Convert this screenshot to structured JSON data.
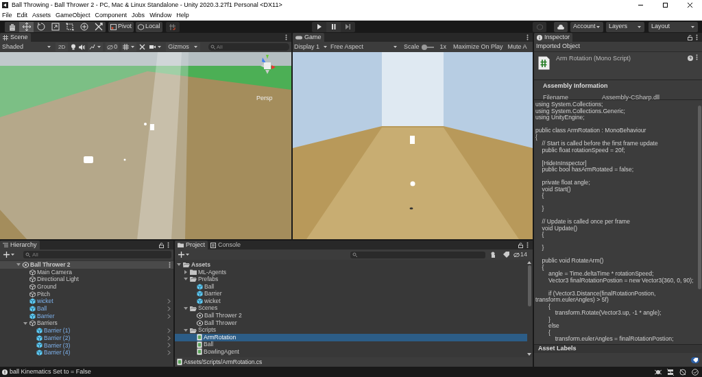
{
  "window": {
    "title": "Ball Throwing - Ball Thrower 2 - PC, Mac & Linux Standalone - Unity 2020.3.27f1 Personal <DX11>"
  },
  "menu": [
    "File",
    "Edit",
    "Assets",
    "GameObject",
    "Component",
    "Jobs",
    "Window",
    "Help"
  ],
  "toolbar": {
    "tools": [
      {
        "kind": "hand",
        "selected": false
      },
      {
        "kind": "move",
        "selected": true
      },
      {
        "kind": "rotate",
        "selected": false
      },
      {
        "kind": "scale",
        "selected": false
      },
      {
        "kind": "rect",
        "selected": false
      },
      {
        "kind": "transform",
        "selected": false
      },
      {
        "kind": "custom",
        "selected": false
      }
    ],
    "pivot": "Pivot",
    "local": "Local",
    "account": "Account",
    "layers": "Layers",
    "layout": "Layout"
  },
  "scene": {
    "tab": "Scene",
    "shading": "Shaded",
    "mode_2d": "2D",
    "hidden_count": "0",
    "gizmos": "Gizmos",
    "search_placeholder": "All",
    "projection": "Persp"
  },
  "game": {
    "tab": "Game",
    "display": "Display 1",
    "aspect": "Free Aspect",
    "scale_label": "Scale",
    "scale": {
      "level": 0
    },
    "scale_value": "1x",
    "maximize": "Maximize On Play",
    "mute": "Mute A"
  },
  "hierarchy": {
    "tab": "Hierarchy",
    "search_placeholder": "All",
    "items": [
      {
        "label": "Ball Thrower 2",
        "kind": "scene",
        "expanded": true,
        "children": [
          {
            "label": "Main Camera",
            "kind": "object"
          },
          {
            "label": "Directional Light",
            "kind": "object"
          },
          {
            "label": "Ground",
            "kind": "object"
          },
          {
            "label": "Pitch",
            "kind": "object"
          },
          {
            "label": "wicket",
            "kind": "prefab"
          },
          {
            "label": "Ball",
            "kind": "prefab"
          },
          {
            "label": "Barrier",
            "kind": "prefab"
          },
          {
            "label": "Barriers",
            "kind": "object",
            "expanded": true,
            "children": [
              {
                "label": "Barrier (1)",
                "kind": "prefab"
              },
              {
                "label": "Barrier (2)",
                "kind": "prefab"
              },
              {
                "label": "Barrier (3)",
                "kind": "prefab"
              },
              {
                "label": "Barrier (4)",
                "kind": "prefab"
              }
            ]
          }
        ]
      }
    ]
  },
  "project": {
    "tabs": [
      {
        "label": "Project",
        "selected": true
      },
      {
        "label": "Console",
        "selected": false
      }
    ],
    "hidden_count": "14",
    "items": [
      {
        "label": "Assets",
        "kind": "folder",
        "expanded": true,
        "selected": false,
        "children": [
          {
            "label": "ML-Agents",
            "kind": "folder",
            "expanded": false,
            "selected": false
          },
          {
            "label": "Prefabs",
            "kind": "folder",
            "expanded": true,
            "selected": false,
            "children": [
              {
                "label": "Ball",
                "kind": "prefab",
                "selected": false
              },
              {
                "label": "Barrier",
                "kind": "prefab",
                "selected": false
              },
              {
                "label": "wicket",
                "kind": "prefab",
                "selected": false
              }
            ]
          },
          {
            "label": "Scenes",
            "kind": "folder",
            "expanded": true,
            "selected": false,
            "children": [
              {
                "label": "Ball Thrower 2",
                "kind": "scene",
                "selected": false
              },
              {
                "label": "Ball Thrower",
                "kind": "scene",
                "selected": false
              }
            ]
          },
          {
            "label": "Scripts",
            "kind": "folder",
            "expanded": true,
            "selected": false,
            "children": [
              {
                "label": "ArmRotation",
                "kind": "script",
                "selected": true
              },
              {
                "label": "Ball",
                "kind": "script",
                "selected": false
              },
              {
                "label": "BowlingAgent",
                "kind": "script",
                "selected": false
              }
            ]
          }
        ]
      }
    ],
    "path": "Assets/Scripts/ArmRotation.cs"
  },
  "inspector": {
    "tab": "Inspector",
    "header": "Imported Object",
    "script_title": "Arm Rotation (Mono Script)",
    "section": "Assembly Information",
    "field_label": "Filename",
    "field_value": "Assembly-CSharp.dll",
    "code": "using System.Collections;\nusing System.Collections.Generic;\nusing UnityEngine;\n\npublic class ArmRotation : MonoBehaviour\n{\n    // Start is called before the first frame update\n    public float rotationSpeed = 20f;\n\n    [HideInInspector]\n    public bool hasArmRotated = false;\n\n    private float angle;\n    void Start()\n    {\n\n    }\n\n    // Update is called once per frame\n    void Update()\n    {\n\n    }\n\n    public void RotateArm()\n    {\n        angle = Time.deltaTime * rotationSpeed;\n        Vector3 finalRotationPostion = new Vector3(360, 0, 90);\n\n        if (Vector3.Distance(finalRotationPostion, transform.eulerAngles) > 5f)\n        {\n            transform.Rotate(Vector3.up, -1 * angle);\n        }\n        else\n        {\n            transform.eulerAngles = finalRotationPostion;",
    "labels_title": "Asset Labels"
  },
  "status_bar": {
    "message": "ball Kinematics Set to = False"
  }
}
